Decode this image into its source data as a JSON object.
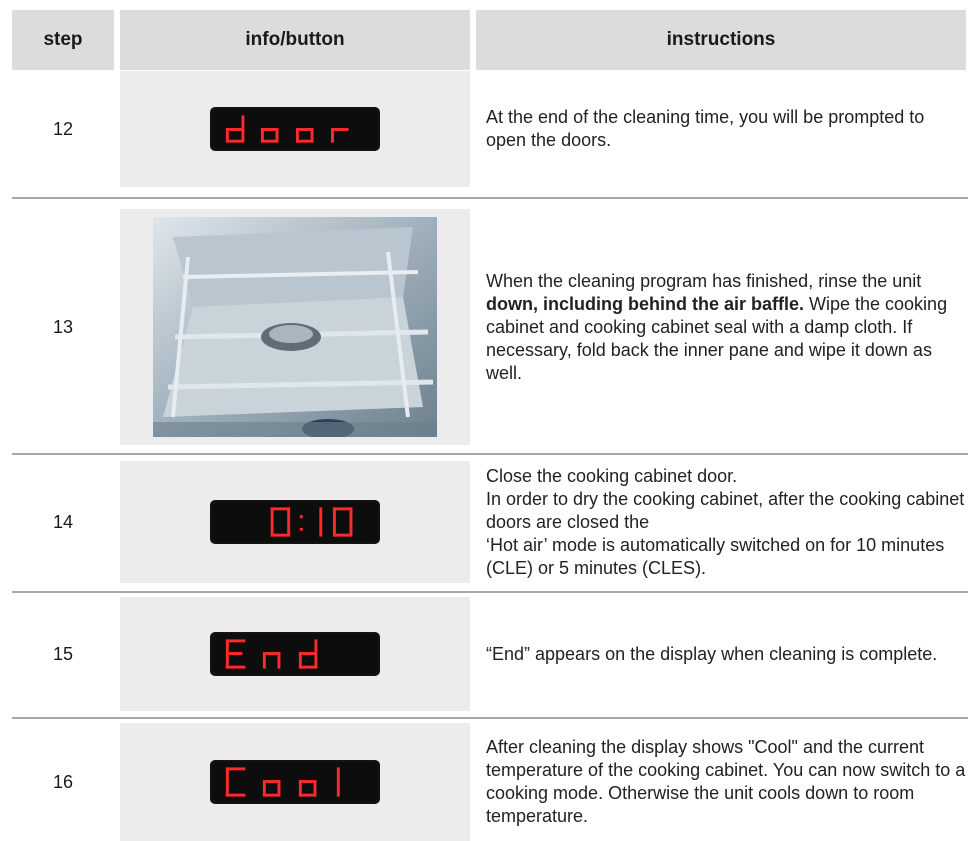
{
  "header": {
    "step": "step",
    "info": "info/button",
    "instructions": "instructions"
  },
  "rows": [
    {
      "step": "12",
      "display": "door",
      "instructions": "At the end of the cleaning time, you will be prompted to open the doors."
    },
    {
      "step": "13",
      "display": "",
      "instructions_pre": "When the cleaning program has finished, rinse the unit ",
      "instructions_bold": "down, including behind the air baffle.",
      "instructions_post": " Wipe the cooking cabinet and cooking cabinet seal with a damp cloth. If necessary, fold back the inner pane and wipe it down as well."
    },
    {
      "step": "14",
      "display": "0:10",
      "instructions_lines": [
        "Close the cooking cabinet door.",
        "In order to dry the cooking cabinet, after the cooking cabinet doors are closed the",
        "‘Hot air’ mode is automatically switched on for 10 minutes (CLE) or 5 minutes (CLES)."
      ]
    },
    {
      "step": "15",
      "display": "End",
      "instructions": "“End” appears on the display when cleaning is complete."
    },
    {
      "step": "16",
      "display": "Cool",
      "instructions": "After cleaning the display shows \"Cool\" and the current temperature of the cooking cabinet. You can now switch to a cooking mode. Otherwise the unit cools down to room temperature."
    }
  ],
  "colors": {
    "segment": "#ff2a2a",
    "display_bg": "#0d0d0d",
    "header_bg": "#dcdcdc",
    "info_bg": "#ececec"
  }
}
